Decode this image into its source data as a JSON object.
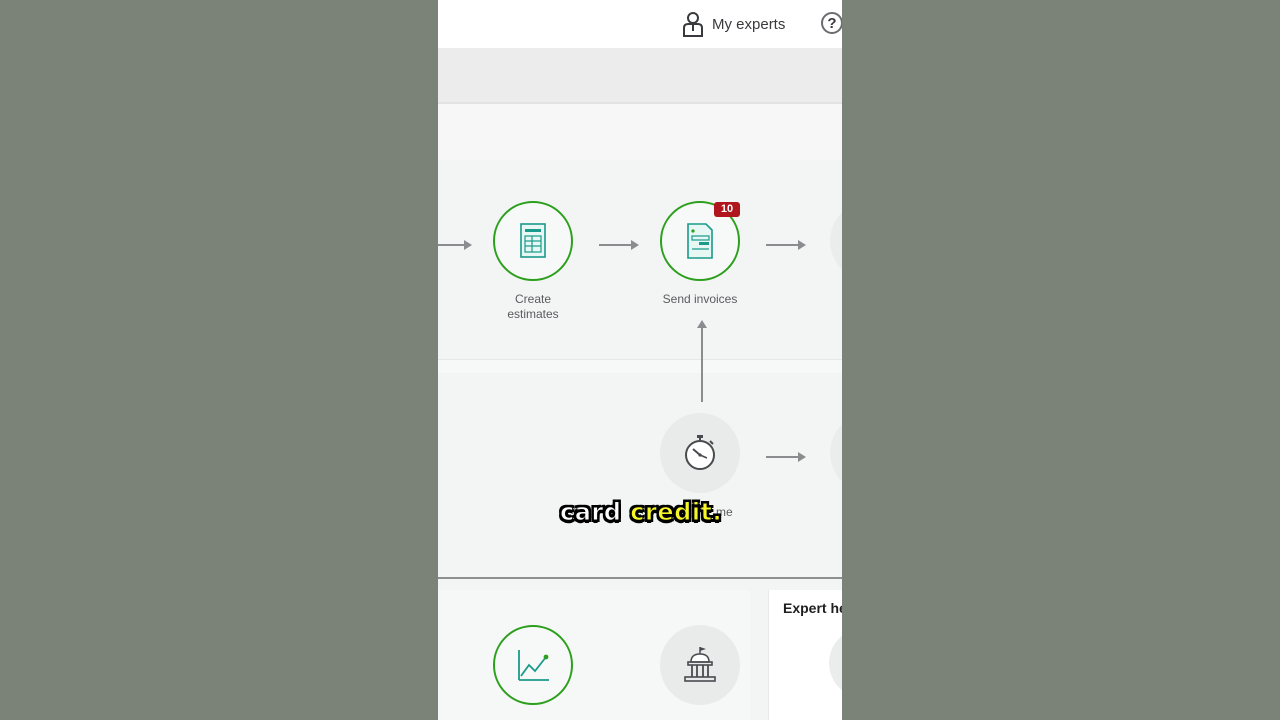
{
  "header": {
    "my_experts_label": "My experts",
    "help_glyph": "?"
  },
  "flow": {
    "create_estimates": {
      "label_line1": "Create",
      "label_line2": "estimates",
      "icon": "estimate-document-icon"
    },
    "send_invoices": {
      "label": "Send invoices",
      "badge_count": "10",
      "icon": "invoice-document-icon"
    },
    "track_time": {
      "label_fragment": "me",
      "icon": "stopwatch-icon"
    }
  },
  "bottom": {
    "node1_icon": "line-chart-icon",
    "node2_icon": "government-building-icon",
    "expert_title": "Expert he"
  },
  "caption": {
    "word1": "card",
    "word2": "credit."
  },
  "colors": {
    "accent_green": "#2ca01c",
    "badge_red": "#b0161e",
    "icon_teal": "#1a9a8a",
    "caption_yellow": "#f6f62a"
  }
}
